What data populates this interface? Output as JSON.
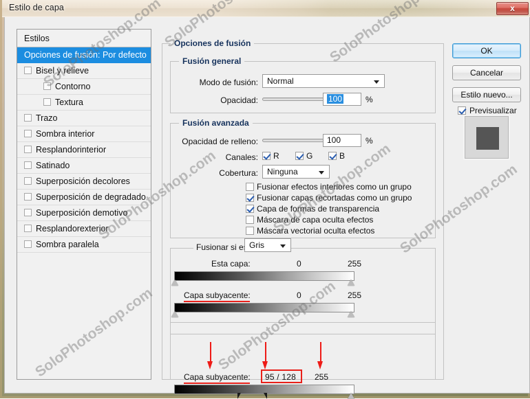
{
  "window": {
    "title": "Estilo de capa",
    "close_label": "x"
  },
  "styles_panel": {
    "header": "Estilos",
    "items": [
      {
        "label": "Opciones de fusión: Por defecto",
        "selected": true,
        "checkbox": false,
        "indent": 0
      },
      {
        "label": "Bisel y relieve",
        "selected": false,
        "checkbox": true,
        "checked": false,
        "indent": 0
      },
      {
        "label": "Contorno",
        "selected": false,
        "checkbox": true,
        "checked": false,
        "indent": 1
      },
      {
        "label": "Textura",
        "selected": false,
        "checkbox": true,
        "checked": false,
        "indent": 1
      },
      {
        "label": "Trazo",
        "selected": false,
        "checkbox": true,
        "checked": false,
        "indent": 0
      },
      {
        "label": "Sombra interior",
        "selected": false,
        "checkbox": true,
        "checked": false,
        "indent": 0
      },
      {
        "label": "Resplandorinterior",
        "selected": false,
        "checkbox": true,
        "checked": false,
        "indent": 0
      },
      {
        "label": "Satinado",
        "selected": false,
        "checkbox": true,
        "checked": false,
        "indent": 0
      },
      {
        "label": "Superposición decolores",
        "selected": false,
        "checkbox": true,
        "checked": false,
        "indent": 0
      },
      {
        "label": "Superposición de degradado",
        "selected": false,
        "checkbox": true,
        "checked": false,
        "indent": 0
      },
      {
        "label": "Superposición demotivo",
        "selected": false,
        "checkbox": true,
        "checked": false,
        "indent": 0
      },
      {
        "label": "Resplandorexterior",
        "selected": false,
        "checkbox": true,
        "checked": false,
        "indent": 0
      },
      {
        "label": "Sombra paralela",
        "selected": false,
        "checkbox": true,
        "checked": false,
        "indent": 0
      }
    ]
  },
  "blending_options": {
    "group_title": "Opciones de fusión",
    "general": {
      "group_title": "Fusión general",
      "blend_mode_label": "Modo de fusión:",
      "blend_mode_value": "Normal",
      "opacity_label": "Opacidad:",
      "opacity_value": "100",
      "opacity_unit": "%"
    },
    "advanced": {
      "group_title": "Fusión avanzada",
      "fill_opacity_label": "Opacidad de relleno:",
      "fill_opacity_value": "100",
      "fill_opacity_unit": "%",
      "channels_label": "Canales:",
      "channels": [
        {
          "name": "R",
          "checked": true
        },
        {
          "name": "G",
          "checked": true
        },
        {
          "name": "B",
          "checked": true
        }
      ],
      "knockout_label": "Cobertura:",
      "knockout_value": "Ninguna",
      "checkboxes": [
        {
          "label": "Fusionar efectos interiores como un grupo",
          "checked": false
        },
        {
          "label": "Fusionar capas recortadas como un grupo",
          "checked": true
        },
        {
          "label": "Capa de formas de transparencia",
          "checked": true
        },
        {
          "label": "Máscara de capa oculta efectos",
          "checked": false
        },
        {
          "label": "Máscara vectorial oculta efectos",
          "checked": false
        }
      ]
    },
    "blend_if": {
      "label": "Fusionar si es:",
      "channel_value": "Gris",
      "this_layer": {
        "label": "Esta capa:",
        "min": "0",
        "max": "255"
      },
      "underlying_layer": {
        "label": "Capa subyacente:",
        "min": "0",
        "max": "255"
      }
    },
    "highlight_panel": {
      "label": "Capa subyacente:",
      "split_value": "95  /  128",
      "max": "255"
    }
  },
  "buttons": {
    "ok": "OK",
    "cancel": "Cancelar",
    "new_style": "Estilo nuevo...",
    "preview_label": "Previsualizar",
    "preview_checked": true
  },
  "watermark": {
    "text": "SoloPhotoshop.com"
  },
  "colors": {
    "selection_blue": "#1c8de0",
    "annotation_red": "#ee1b17",
    "group_title": "#16325c"
  }
}
